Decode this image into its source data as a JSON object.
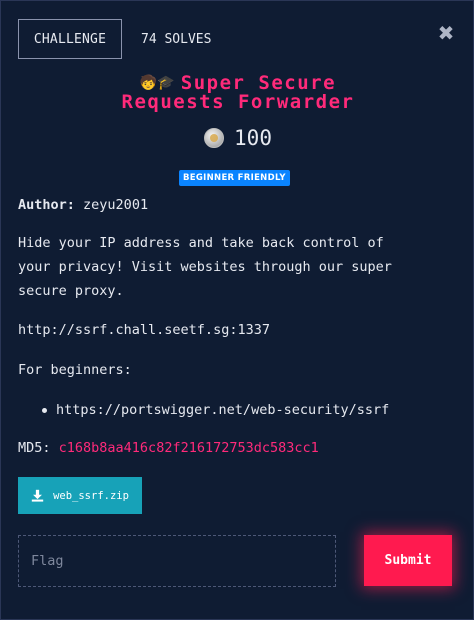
{
  "header": {
    "tab_label": "CHALLENGE",
    "solves_text": "74 SOLVES",
    "close_icon": "close-icon"
  },
  "challenge": {
    "title_emoji": "🧒🎓",
    "title_line1": "Super Secure",
    "title_line2": "Requests Forwarder",
    "points_icon": "coin-icon",
    "points": "100",
    "badge": "BEGINNER FRIENDLY",
    "author_label": "Author:",
    "author": "zeyu2001",
    "description": "Hide your IP address and take back control of your privacy! Visit websites through our super secure proxy.",
    "service_url": "http://ssrf.chall.seetf.sg:1337",
    "beginners_label": "For beginners:",
    "resources": [
      "https://portswigger.net/web-security/ssrf"
    ],
    "md5_label": "MD5:",
    "md5_value": "c168b8aa416c82f216172753dc583cc1",
    "download_label": "web_ssrf.zip",
    "download_icon": "download-icon"
  },
  "flag": {
    "value": "",
    "placeholder": "Flag",
    "submit_label": "Submit"
  },
  "colors": {
    "background": "#0f1c33",
    "accent_pink": "#ff2a7a",
    "submit": "#ff1a4f",
    "badge": "#0a84ff",
    "download": "#17a2b8"
  }
}
